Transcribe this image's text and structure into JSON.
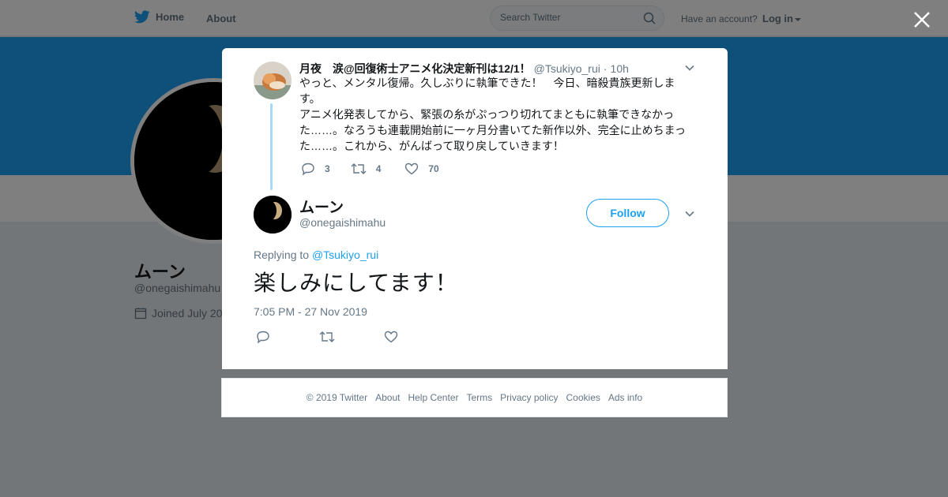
{
  "nav": {
    "home_label": "Home",
    "about_label": "About",
    "search_placeholder": "Search Twitter",
    "have_account": "Have an account?",
    "login_label": "Log in"
  },
  "profile": {
    "name": "ムーン",
    "handle": "@onegaishimahu",
    "joined": "Joined July 20"
  },
  "ancestor_tweet": {
    "author_name": "月夜　涙@回復術士アニメ化決定新刊は12/1！",
    "author_handle": "@Tsukiyo_rui",
    "separator": "·",
    "time": "10h",
    "text": "やっと、メンタル復帰。久しぶりに執筆できた！　今日、暗殺貴族更新します。\nアニメ化発表してから、緊張の糸がぷっつり切れてまともに執筆できなかった……。なろうも連載開始前に一ヶ月分書いてた新作以外、完全に止めちまった……。これから、がんばって取り戻していきます！",
    "reply_count": "3",
    "retweet_count": "4",
    "like_count": "70"
  },
  "main_tweet": {
    "author_name": "ムーン",
    "author_handle": "@onegaishimahu",
    "follow_label": "Follow",
    "replying_prefix": "Replying to",
    "replying_to": "@Tsukiyo_rui",
    "text": "楽しみにしてます！",
    "timestamp": "7:05 PM - 27 Nov 2019"
  },
  "footer": {
    "copyright": "© 2019 Twitter",
    "links": [
      "About",
      "Help Center",
      "Terms",
      "Privacy policy",
      "Cookies",
      "Ads info"
    ]
  },
  "colors": {
    "brand": "#1da1f2",
    "thread_line": "#a4d9f9",
    "secondary_text": "#657786"
  },
  "icons": [
    "twitter-bird-icon",
    "search-icon",
    "calendar-icon",
    "close-icon",
    "chevron-down-icon",
    "reply-icon",
    "retweet-icon",
    "heart-icon"
  ]
}
